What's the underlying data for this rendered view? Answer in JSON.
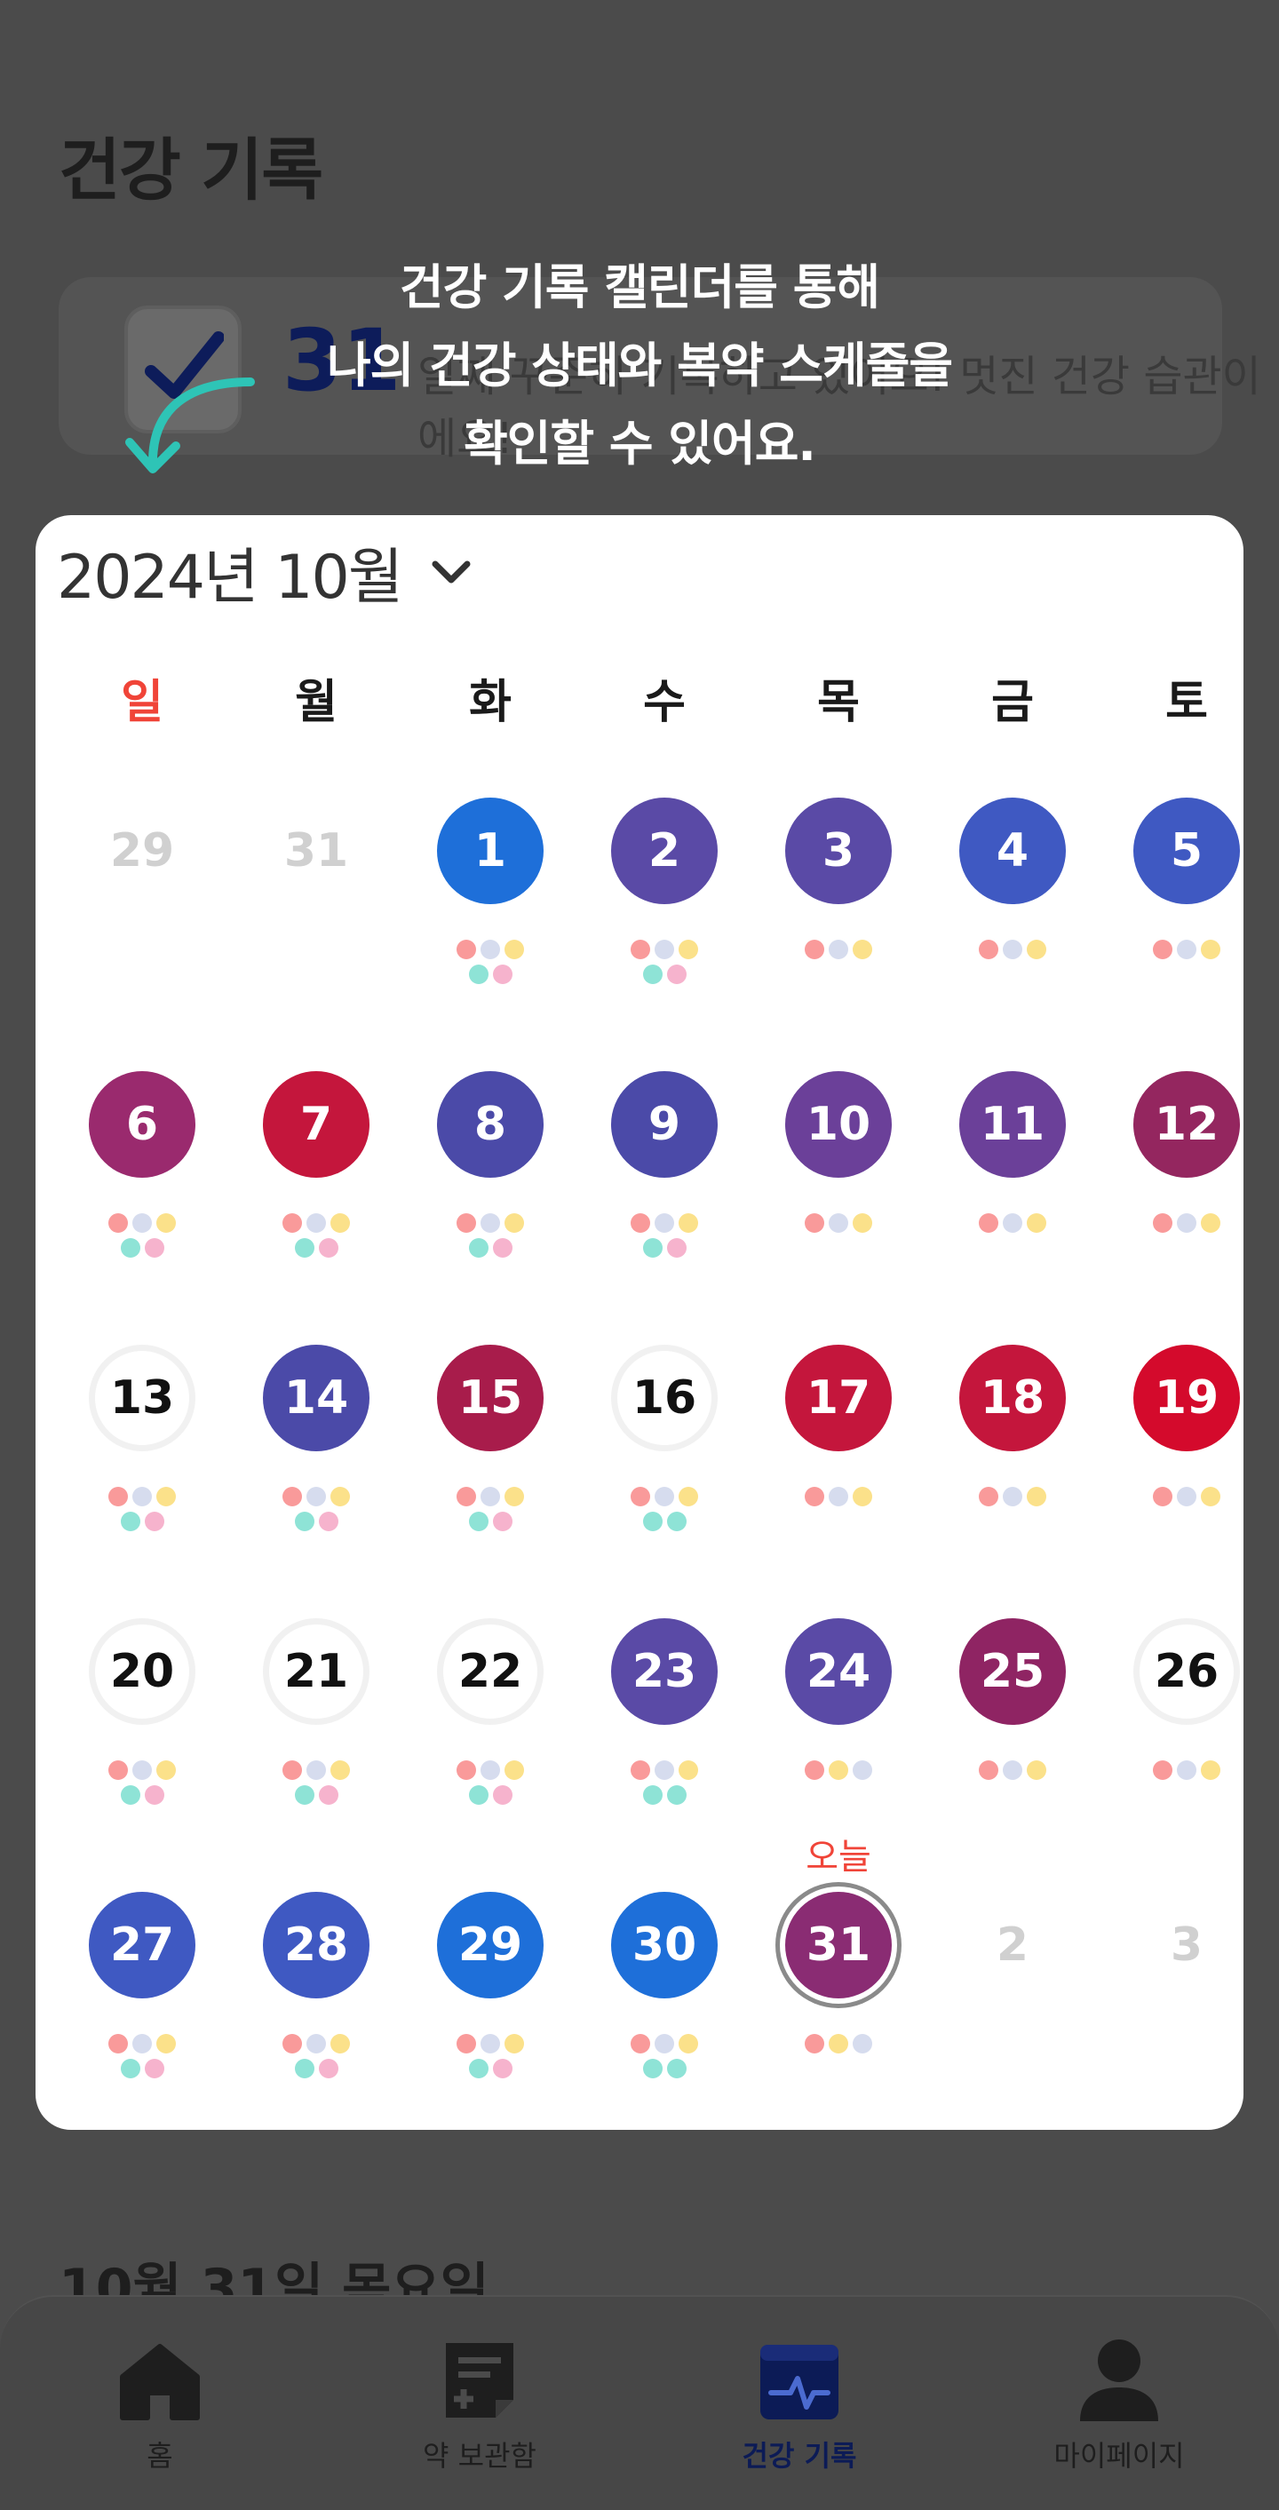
{
  "page": {
    "title": "건강 기록",
    "banner_number": "31",
    "banner_text": "일째 꾸준히 기록하고 있어요! 멋진 건강 습관이에요!",
    "section_title": "10월 31일 목요일"
  },
  "tooltip": {
    "lines": [
      "건강 기록 캘린더를 통해",
      "나의 건강 상태와 복약 스케줄을",
      "확인할 수 있어요."
    ]
  },
  "calendar": {
    "month_label": "2024년 10월",
    "weekdays": [
      "일",
      "월",
      "화",
      "수",
      "목",
      "금",
      "토"
    ],
    "today_label": "오늘",
    "weeks": [
      [
        {
          "d": "29",
          "c": "other"
        },
        {
          "d": "31",
          "c": "other"
        },
        {
          "d": "1",
          "c": "#1e6fd9",
          "dots": "4"
        },
        {
          "d": "2",
          "c": "#5a4aa6",
          "dots": "4"
        },
        {
          "d": "3",
          "c": "#5a4aa6",
          "dots": "3"
        },
        {
          "d": "4",
          "c": "#3f59c2",
          "dots": "3"
        },
        {
          "d": "5",
          "c": "#3f59c2",
          "dots": "3"
        }
      ],
      [
        {
          "d": "6",
          "c": "#9a2a6e",
          "dots": "4"
        },
        {
          "d": "7",
          "c": "#c4163c",
          "dots": "4"
        },
        {
          "d": "8",
          "c": "#4b4aa8",
          "dots": "4"
        },
        {
          "d": "9",
          "c": "#4b4aa8",
          "dots": "4"
        },
        {
          "d": "10",
          "c": "#6b4099",
          "dots": "3"
        },
        {
          "d": "11",
          "c": "#6b4099",
          "dots": "3"
        },
        {
          "d": "12",
          "c": "#94265f",
          "dots": "3"
        }
      ],
      [
        {
          "d": "13",
          "c": "empty",
          "dots": "4"
        },
        {
          "d": "14",
          "c": "#4b4aa8",
          "dots": "4"
        },
        {
          "d": "15",
          "c": "#a81c4b",
          "dots": "4"
        },
        {
          "d": "16",
          "c": "empty",
          "dots": "4t"
        },
        {
          "d": "17",
          "c": "#c4163c",
          "dots": "3"
        },
        {
          "d": "18",
          "c": "#c4163c",
          "dots": "3"
        },
        {
          "d": "19",
          "c": "#d40a2c",
          "dots": "3"
        }
      ],
      [
        {
          "d": "20",
          "c": "empty",
          "dots": "4"
        },
        {
          "d": "21",
          "c": "empty",
          "dots": "4"
        },
        {
          "d": "22",
          "c": "empty",
          "dots": "4"
        },
        {
          "d": "23",
          "c": "#5a4aa6",
          "dots": "4t"
        },
        {
          "d": "24",
          "c": "#5a4aa6",
          "dots": "3y"
        },
        {
          "d": "25",
          "c": "#8f2463",
          "dots": "3"
        },
        {
          "d": "26",
          "c": "empty",
          "dots": "3"
        }
      ],
      [
        {
          "d": "27",
          "c": "#3f59c2",
          "dots": "4"
        },
        {
          "d": "28",
          "c": "#3f59c2",
          "dots": "4"
        },
        {
          "d": "29",
          "c": "#1e6fd9",
          "dots": "4"
        },
        {
          "d": "30",
          "c": "#1e6fd9",
          "dots": "4t"
        },
        {
          "d": "31",
          "c": "#8a2c73",
          "dots": "3y",
          "today": true
        },
        {
          "d": "2",
          "c": "other"
        },
        {
          "d": "3",
          "c": "other"
        }
      ]
    ]
  },
  "nav": {
    "items": [
      {
        "label": "홈",
        "icon": "home-icon",
        "active": false
      },
      {
        "label": "약 보관함",
        "icon": "medicine-box-icon",
        "active": false
      },
      {
        "label": "건강 기록",
        "icon": "health-record-icon",
        "active": true
      },
      {
        "label": "마이페이지",
        "icon": "profile-icon",
        "active": false
      }
    ]
  },
  "colors": {
    "sunday": "#f04438",
    "today_label": "#f04438",
    "active_nav": "#0c1b56",
    "tooltip_arrow": "#2ec4b6"
  }
}
